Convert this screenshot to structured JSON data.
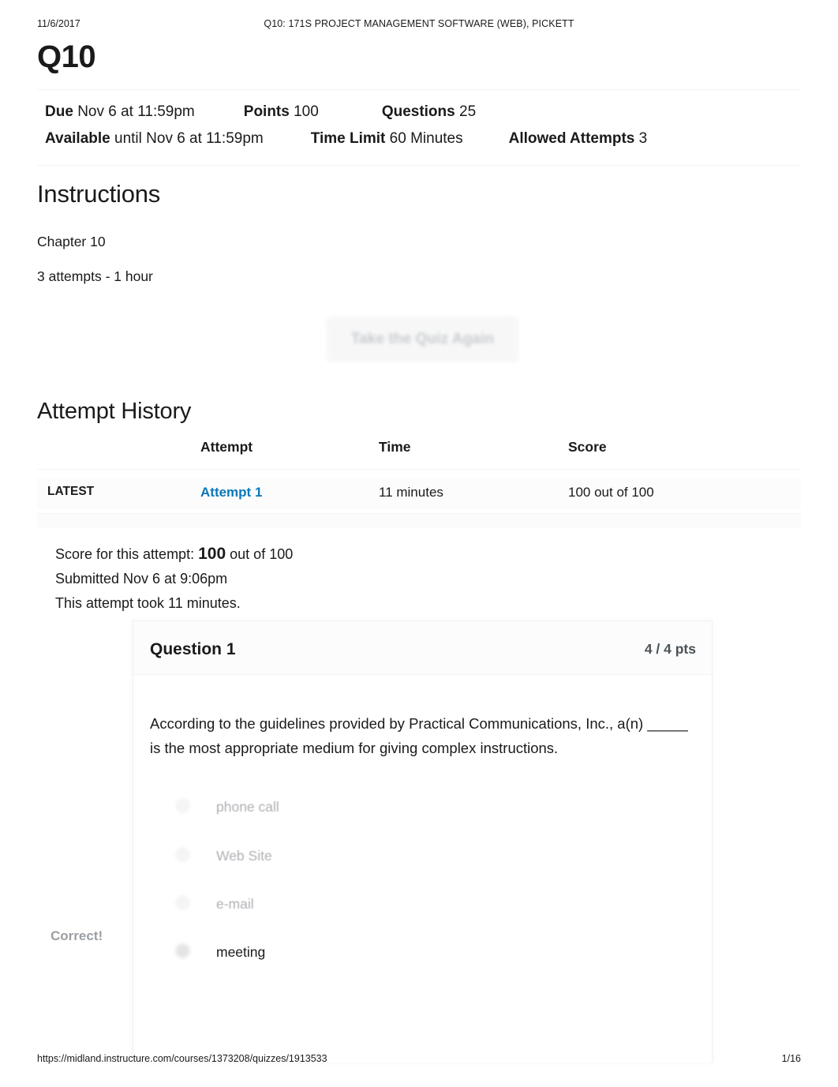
{
  "print_header": {
    "date": "11/6/2017",
    "title": "Q10: 171S PROJECT MANAGEMENT SOFTWARE (WEB), PICKETT"
  },
  "quiz": {
    "title": "Q10",
    "meta": {
      "due_label": "Due",
      "due_value": "Nov 6 at 11:59pm",
      "points_label": "Points",
      "points_value": "100",
      "questions_label": "Questions",
      "questions_value": "25",
      "available_label": "Available",
      "available_value": "until Nov 6 at 11:59pm",
      "time_limit_label": "Time Limit",
      "time_limit_value": "60 Minutes",
      "allowed_attempts_label": "Allowed Attempts",
      "allowed_attempts_value": "3"
    }
  },
  "instructions": {
    "heading": "Instructions",
    "line1": "Chapter 10",
    "line2": "3 attempts - 1 hour"
  },
  "retake": {
    "label": "Take the Quiz Again"
  },
  "attempt_history": {
    "heading": "Attempt History",
    "columns": {
      "flag": "",
      "attempt": "Attempt",
      "time": "Time",
      "score": "Score"
    },
    "rows": [
      {
        "flag": "LATEST",
        "attempt": "Attempt 1",
        "time": "11 minutes",
        "score": "100 out of 100"
      }
    ]
  },
  "score_summary": {
    "prefix": "Score for this attempt:",
    "score": "100",
    "suffix": "out of 100",
    "submitted": "Submitted Nov 6 at 9:06pm",
    "duration": "This attempt took 11 minutes."
  },
  "question": {
    "correct_label": "Correct!",
    "name": "Question 1",
    "points": "4 / 4 pts",
    "text": "According to the guidelines provided by Practical Communications, Inc., a(n) _____ is the most appropriate medium for giving complex instructions.",
    "answers": [
      {
        "label": "phone call",
        "selected": false
      },
      {
        "label": "Web Site",
        "selected": false
      },
      {
        "label": "e-mail",
        "selected": false
      },
      {
        "label": "meeting",
        "selected": true
      }
    ]
  },
  "print_footer": {
    "url": "https://midland.instructure.com/courses/1373208/quizzes/1913533",
    "page": "1/16"
  },
  "colors": {
    "link": "#0b78b8",
    "text": "#1a1a1a",
    "muted": "#9b9fa3"
  }
}
